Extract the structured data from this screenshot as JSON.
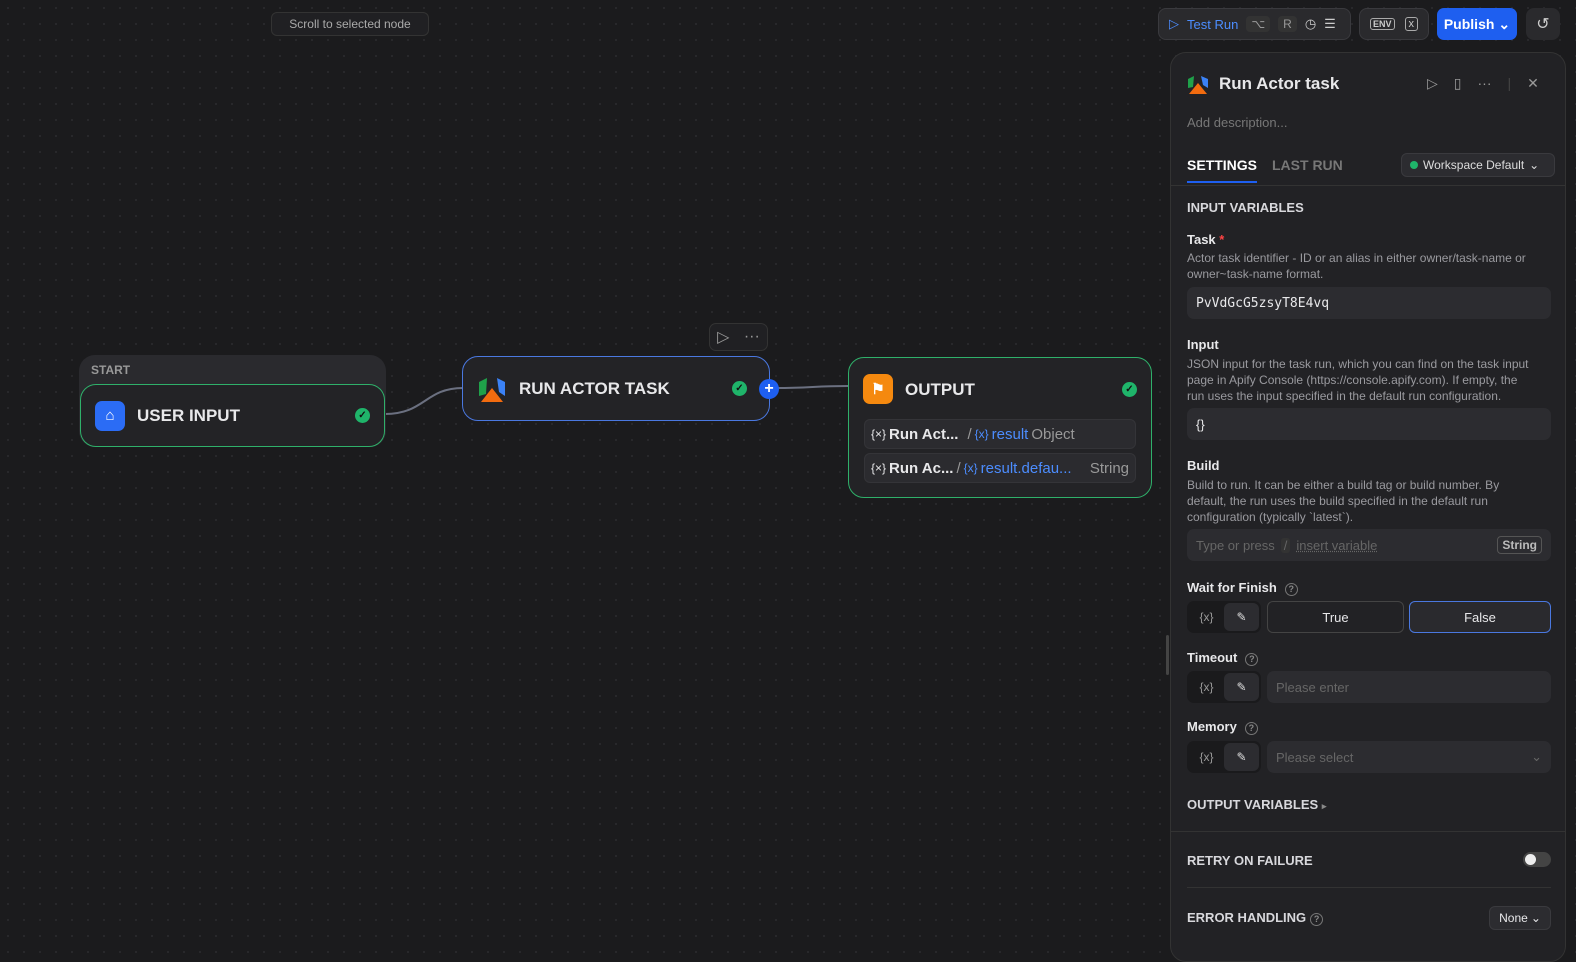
{
  "canvas": {
    "scroll_button": "Scroll to selected node"
  },
  "toolbar": {
    "test_run": "Test Run",
    "shortcut_mod": "⌥",
    "shortcut_key": "R",
    "env_label": "ENV",
    "publish": "Publish"
  },
  "nodes": {
    "start": {
      "group_label": "START",
      "title": "USER INPUT"
    },
    "actor": {
      "title": "RUN ACTOR TASK"
    },
    "output": {
      "title": "OUTPUT",
      "rows": [
        {
          "source": "Run Act...",
          "var": "result",
          "type": "Object"
        },
        {
          "source": "Run Ac...",
          "var": "result.defau...",
          "type": "String"
        }
      ]
    }
  },
  "panel": {
    "title": "Run Actor task",
    "description_placeholder": "Add description...",
    "tabs": [
      {
        "label": "SETTINGS",
        "active": true
      },
      {
        "label": "LAST RUN",
        "active": false
      }
    ],
    "workspace": "Workspace Default",
    "input_section": "INPUT VARIABLES",
    "task": {
      "label": "Task",
      "required": "*",
      "desc": "Actor task identifier - ID or an alias in either owner/task-name or owner~task-name format.",
      "value": "PvVdGcG5zsyT8E4vq"
    },
    "input": {
      "label": "Input",
      "desc": "JSON input for the task run, which you can find on the task input page in Apify Console (https://console.apify.com). If empty, the run uses the input specified in the default run configuration.",
      "value": "{}"
    },
    "build": {
      "label": "Build",
      "desc": "Build to run. It can be either a build tag or build number. By default, the run uses the build specified in the default run configuration (typically `latest`).",
      "placeholder_a": "Type or press",
      "slash": "/",
      "placeholder_b": "insert variable",
      "type": "String"
    },
    "wait": {
      "label": "Wait for Finish",
      "true": "True",
      "false": "False",
      "selected": "False"
    },
    "var_toggle": "{x}",
    "timeout": {
      "label": "Timeout",
      "placeholder": "Please enter"
    },
    "memory": {
      "label": "Memory",
      "placeholder": "Please select"
    },
    "output_section": "OUTPUT VARIABLES",
    "retry": {
      "label": "RETRY ON FAILURE",
      "enabled": false
    },
    "error": {
      "label": "ERROR HANDLING",
      "value": "None"
    }
  },
  "colors": {
    "accent": "#1e5ff0",
    "success": "#1fb46a",
    "output_icon": "#f5890f"
  }
}
